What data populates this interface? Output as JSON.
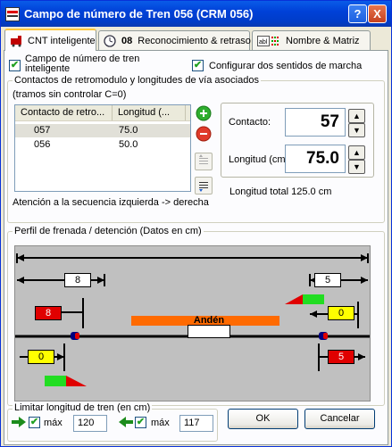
{
  "window": {
    "title": "Campo de número de Tren 056 (CRM 056)",
    "help_label": "?",
    "close_label": "X"
  },
  "tabs": [
    {
      "label": "CNT inteligente",
      "icon": "train-icon"
    },
    {
      "label": "Reconocimiento & retraso",
      "icon": "clock-icon",
      "badge": "08"
    },
    {
      "label": "Nombre & Matriz",
      "icon": "text-icon"
    }
  ],
  "options": {
    "cnt_inteligente_label": "Campo de número de tren inteligente",
    "cnt_inteligente_checked": true,
    "dos_sentidos_label": "Configurar dos sentidos de marcha",
    "dos_sentidos_checked": true
  },
  "contactos": {
    "legend": "Contactos de retromodulo y longitudes de vía asociados",
    "note": "(tramos sin controlar C=0)",
    "columns": [
      "Contacto de retro...",
      "Longitud (..."
    ],
    "rows": [
      {
        "contacto": "057",
        "longitud": "75.0"
      },
      {
        "contacto": "056",
        "longitud": "50.0"
      }
    ],
    "warning": "Atención a la secuencia izquierda -> derecha",
    "contacto_label": "Contacto:",
    "contacto_value": "57",
    "longitud_label": "Longitud (cm):",
    "longitud_value": "75.0",
    "total_label": "Longitud total 125.0 cm"
  },
  "perfil": {
    "legend": "Perfil de frenada / detención (Datos en cm)",
    "box_left_white": "8",
    "box_right_white": "5",
    "box_left_red": "8",
    "box_right_yellow": "0",
    "box_left_yellow": "0",
    "box_right_red": "5",
    "platform_label": "Andén"
  },
  "limitar": {
    "legend": "Limitar longitud de tren (en cm)",
    "left_checked": true,
    "left_label": "máx",
    "left_value": "120",
    "right_checked": true,
    "right_label": "máx",
    "right_value": "117"
  },
  "buttons": {
    "ok": "OK",
    "cancel": "Cancelar"
  },
  "colors": {
    "titlebar": "#0041d8",
    "red": "#e00000",
    "yellow": "#ffff00",
    "orange": "#ff6a00",
    "green": "#21a121"
  }
}
